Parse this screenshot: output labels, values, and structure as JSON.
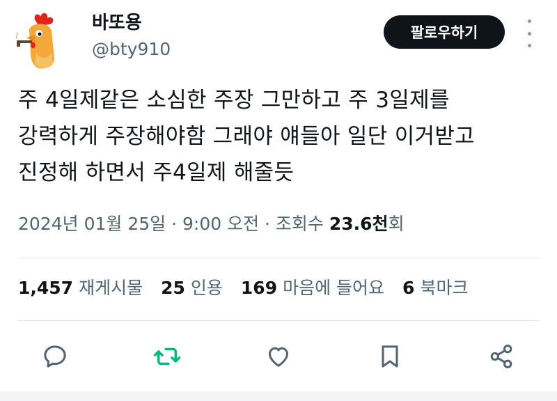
{
  "author": {
    "name": "바또용",
    "handle": "@bty910"
  },
  "follow_label": "팔로우하기",
  "tweet": {
    "lines": [
      "주 4일제같은 소심한 주장 그만하고 주 3일제를",
      "강력하게 주장해야함 그래야 얘들아 일단 이거받고",
      "진정해 하면서 주4일제 해줄듯"
    ]
  },
  "meta": {
    "date": "2024년 01월 25일",
    "sep1": " · ",
    "time": "9:00 오전",
    "sep2": " · ",
    "views_label": "조회수 ",
    "views_value": "23.6천",
    "views_suffix": "회"
  },
  "stats": {
    "retweets": {
      "num": "1,457",
      "label": "재게시물"
    },
    "quotes": {
      "num": "25",
      "label": "인용"
    },
    "likes": {
      "num": "169",
      "label": "마음에 들어요"
    },
    "bookmarks": {
      "num": "6",
      "label": "북마크"
    }
  },
  "icons": {
    "reply": "speech-bubble-icon",
    "retweet": "retweet-arrows-icon",
    "like": "heart-icon",
    "bookmark": "bookmark-icon",
    "share": "share-nodes-icon"
  },
  "colors": {
    "retweet_active": "#00ba7c",
    "text_primary": "#0f1419",
    "text_secondary": "#536471"
  }
}
